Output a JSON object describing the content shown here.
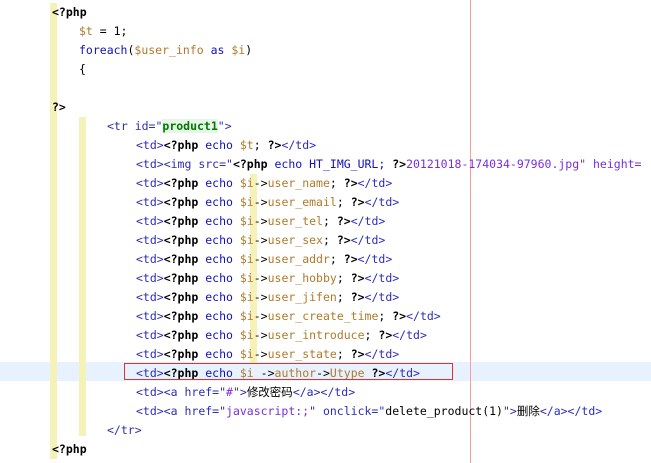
{
  "code_lines": [
    {
      "segs": [
        {
          "t": "<?php",
          "c": "php"
        }
      ]
    },
    {
      "segs": [
        {
          "t": "$t",
          "c": "var"
        },
        {
          "t": " = 1;",
          "c": "plain"
        }
      ]
    },
    {
      "segs": [
        {
          "t": "foreach",
          "c": "kw"
        },
        {
          "t": "(",
          "c": "plain"
        },
        {
          "t": "$user_info",
          "c": "var"
        },
        {
          "t": " as ",
          "c": "kw"
        },
        {
          "t": "$i",
          "c": "var"
        },
        {
          "t": ")",
          "c": "plain"
        }
      ]
    },
    {
      "segs": [
        {
          "t": "{",
          "c": "plain"
        }
      ]
    },
    {
      "segs": []
    },
    {
      "segs": [
        {
          "t": "?>",
          "c": "php"
        }
      ]
    },
    {
      "segs": [
        {
          "t": "<tr id=\"",
          "c": "tag"
        },
        {
          "t": "product1",
          "c": "idval"
        },
        {
          "t": "\">",
          "c": "tag"
        }
      ]
    },
    {
      "segs": [
        {
          "t": "<td>",
          "c": "tag"
        },
        {
          "t": "<?php",
          "c": "php"
        },
        {
          "t": " echo ",
          "c": "kw"
        },
        {
          "t": "$t",
          "c": "var"
        },
        {
          "t": "; ",
          "c": "plain"
        },
        {
          "t": "?>",
          "c": "php"
        },
        {
          "t": "</td>",
          "c": "tag"
        }
      ]
    },
    {
      "segs": [
        {
          "t": "<td>",
          "c": "tag"
        },
        {
          "t": "<img src=\"",
          "c": "tag"
        },
        {
          "t": "<?php",
          "c": "php"
        },
        {
          "t": " echo HT_IMG_URL; ",
          "c": "kw"
        },
        {
          "t": "?>",
          "c": "php"
        },
        {
          "t": "20121018-174034-97960.jpg\" height=",
          "c": "str"
        }
      ]
    },
    {
      "segs": [
        {
          "t": "<td>",
          "c": "tag"
        },
        {
          "t": "<?php",
          "c": "php"
        },
        {
          "t": " echo ",
          "c": "kw"
        },
        {
          "t": "$i",
          "c": "var"
        },
        {
          "t": "->",
          "c": "plain"
        },
        {
          "t": "user_name",
          "c": "var"
        },
        {
          "t": "; ",
          "c": "plain"
        },
        {
          "t": "?>",
          "c": "php"
        },
        {
          "t": "</td>",
          "c": "tag"
        }
      ]
    },
    {
      "segs": [
        {
          "t": "<td>",
          "c": "tag"
        },
        {
          "t": "<?php",
          "c": "php"
        },
        {
          "t": " echo ",
          "c": "kw"
        },
        {
          "t": "$i",
          "c": "var"
        },
        {
          "t": "->",
          "c": "plain"
        },
        {
          "t": "user_email",
          "c": "var"
        },
        {
          "t": "; ",
          "c": "plain"
        },
        {
          "t": "?>",
          "c": "php"
        },
        {
          "t": "</td>",
          "c": "tag"
        }
      ]
    },
    {
      "segs": [
        {
          "t": "<td>",
          "c": "tag"
        },
        {
          "t": "<?php",
          "c": "php"
        },
        {
          "t": " echo ",
          "c": "kw"
        },
        {
          "t": "$i",
          "c": "var"
        },
        {
          "t": "->",
          "c": "plain"
        },
        {
          "t": "user_tel",
          "c": "var"
        },
        {
          "t": "; ",
          "c": "plain"
        },
        {
          "t": "?>",
          "c": "php"
        },
        {
          "t": "</td>",
          "c": "tag"
        }
      ]
    },
    {
      "segs": [
        {
          "t": "<td>",
          "c": "tag"
        },
        {
          "t": "<?php",
          "c": "php"
        },
        {
          "t": " echo ",
          "c": "kw"
        },
        {
          "t": "$i",
          "c": "var"
        },
        {
          "t": "->",
          "c": "plain"
        },
        {
          "t": "user_sex",
          "c": "var"
        },
        {
          "t": "; ",
          "c": "plain"
        },
        {
          "t": "?>",
          "c": "php"
        },
        {
          "t": "</td>",
          "c": "tag"
        }
      ]
    },
    {
      "segs": [
        {
          "t": "<td>",
          "c": "tag"
        },
        {
          "t": "<?php",
          "c": "php"
        },
        {
          "t": " echo ",
          "c": "kw"
        },
        {
          "t": "$i",
          "c": "var"
        },
        {
          "t": "->",
          "c": "plain"
        },
        {
          "t": "user_addr",
          "c": "var"
        },
        {
          "t": "; ",
          "c": "plain"
        },
        {
          "t": "?>",
          "c": "php"
        },
        {
          "t": "</td>",
          "c": "tag"
        }
      ]
    },
    {
      "segs": [
        {
          "t": "<td>",
          "c": "tag"
        },
        {
          "t": "<?php",
          "c": "php"
        },
        {
          "t": " echo ",
          "c": "kw"
        },
        {
          "t": "$i",
          "c": "var"
        },
        {
          "t": "->",
          "c": "plain"
        },
        {
          "t": "user_hobby",
          "c": "var"
        },
        {
          "t": "; ",
          "c": "plain"
        },
        {
          "t": "?>",
          "c": "php"
        },
        {
          "t": "</td>",
          "c": "tag"
        }
      ]
    },
    {
      "segs": [
        {
          "t": "<td>",
          "c": "tag"
        },
        {
          "t": "<?php",
          "c": "php"
        },
        {
          "t": " echo ",
          "c": "kw"
        },
        {
          "t": "$i",
          "c": "var"
        },
        {
          "t": "->",
          "c": "plain"
        },
        {
          "t": "user_jifen",
          "c": "var"
        },
        {
          "t": "; ",
          "c": "plain"
        },
        {
          "t": "?>",
          "c": "php"
        },
        {
          "t": "</td>",
          "c": "tag"
        }
      ]
    },
    {
      "segs": [
        {
          "t": "<td>",
          "c": "tag"
        },
        {
          "t": "<?php",
          "c": "php"
        },
        {
          "t": " echo ",
          "c": "kw"
        },
        {
          "t": "$i",
          "c": "var"
        },
        {
          "t": "->",
          "c": "plain"
        },
        {
          "t": "user_create_time",
          "c": "var"
        },
        {
          "t": "; ",
          "c": "plain"
        },
        {
          "t": "?>",
          "c": "php"
        },
        {
          "t": "</td>",
          "c": "tag"
        }
      ]
    },
    {
      "segs": [
        {
          "t": "<td>",
          "c": "tag"
        },
        {
          "t": "<?php",
          "c": "php"
        },
        {
          "t": " echo ",
          "c": "kw"
        },
        {
          "t": "$i",
          "c": "var"
        },
        {
          "t": "->",
          "c": "plain"
        },
        {
          "t": "user_introduce",
          "c": "var"
        },
        {
          "t": "; ",
          "c": "plain"
        },
        {
          "t": "?>",
          "c": "php"
        },
        {
          "t": "</td>",
          "c": "tag"
        }
      ]
    },
    {
      "segs": [
        {
          "t": "<td>",
          "c": "tag"
        },
        {
          "t": "<?php",
          "c": "php"
        },
        {
          "t": " echo ",
          "c": "kw"
        },
        {
          "t": "$i",
          "c": "var"
        },
        {
          "t": "->",
          "c": "plain"
        },
        {
          "t": "user_state",
          "c": "var"
        },
        {
          "t": "; ",
          "c": "plain"
        },
        {
          "t": "?>",
          "c": "php"
        },
        {
          "t": "</td>",
          "c": "tag"
        }
      ]
    },
    {
      "segs": [
        {
          "t": "<td>",
          "c": "tag"
        },
        {
          "t": "<?php",
          "c": "php"
        },
        {
          "t": " echo ",
          "c": "kw"
        },
        {
          "t": "$i",
          "c": "var"
        },
        {
          "t": " ->",
          "c": "plain"
        },
        {
          "t": "author",
          "c": "var"
        },
        {
          "t": "->",
          "c": "plain"
        },
        {
          "t": "Utype",
          "c": "var"
        },
        {
          "t": " ",
          "c": "plain"
        },
        {
          "t": "?>",
          "c": "php"
        },
        {
          "t": "</td>",
          "c": "tag"
        }
      ]
    },
    {
      "segs": [
        {
          "t": "<td>",
          "c": "tag"
        },
        {
          "t": "<a href=\"",
          "c": "tag"
        },
        {
          "t": "#",
          "c": "str"
        },
        {
          "t": "\">",
          "c": "tag"
        },
        {
          "t": "修改密码",
          "c": "plain"
        },
        {
          "t": "</a>",
          "c": "tag"
        },
        {
          "t": "</td>",
          "c": "tag"
        }
      ]
    },
    {
      "segs": [
        {
          "t": "<td>",
          "c": "tag"
        },
        {
          "t": "<a href=\"",
          "c": "tag"
        },
        {
          "t": "javascript:;",
          "c": "str"
        },
        {
          "t": "\" onclick=\"",
          "c": "tag"
        },
        {
          "t": "delete_product(1)",
          "c": "plain"
        },
        {
          "t": "\">",
          "c": "tag"
        },
        {
          "t": "删除",
          "c": "plain"
        },
        {
          "t": "</a>",
          "c": "tag"
        },
        {
          "t": "</td>",
          "c": "tag"
        }
      ]
    },
    {
      "segs": [
        {
          "t": "</tr>",
          "c": "tag"
        }
      ]
    },
    {
      "segs": [
        {
          "t": "<?php",
          "c": "php"
        }
      ]
    }
  ],
  "highlighted_line_number": 20,
  "colors": {
    "background": "#ffffff",
    "current_line": "#e8f2fe",
    "highlight_box_border": "#e03030",
    "right_margin_line": "#f2a0a0"
  }
}
